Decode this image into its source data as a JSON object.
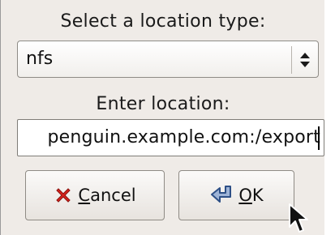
{
  "dialog": {
    "location_type_label": "Select a location type:",
    "location_type_value": "nfs",
    "location_label": "Enter location:",
    "location_value": "penguin.example.com:/export",
    "cancel_mnemonic": "C",
    "cancel_rest": "ancel",
    "ok_mnemonic": "O",
    "ok_rest": "K"
  },
  "icons": {
    "combo_arrows": "up-down-arrows-icon",
    "cancel": "red-x-icon",
    "ok": "return-arrow-icon",
    "pointer": "mouse-pointer-icon"
  },
  "colors": {
    "dialog_bg": "#efebe7",
    "cancel_icon": "#d9221c",
    "ok_icon_fill": "#9db3d6",
    "ok_icon_stroke": "#2d4f86"
  }
}
